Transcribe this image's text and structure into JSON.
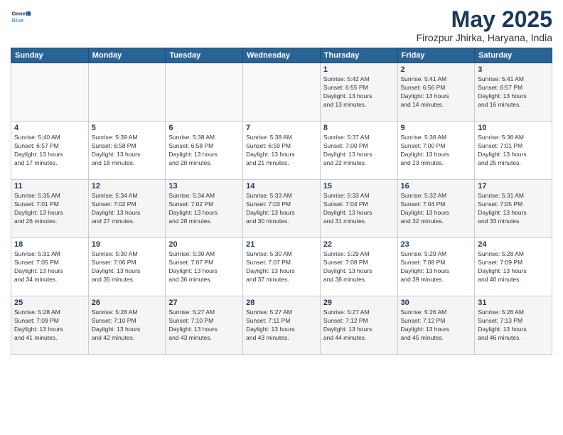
{
  "header": {
    "logo_line1": "General",
    "logo_line2": "Blue",
    "month_title": "May 2025",
    "location": "Firozpur Jhirka, Haryana, India"
  },
  "days_of_week": [
    "Sunday",
    "Monday",
    "Tuesday",
    "Wednesday",
    "Thursday",
    "Friday",
    "Saturday"
  ],
  "weeks": [
    [
      {
        "day": "",
        "content": ""
      },
      {
        "day": "",
        "content": ""
      },
      {
        "day": "",
        "content": ""
      },
      {
        "day": "",
        "content": ""
      },
      {
        "day": "1",
        "content": "Sunrise: 5:42 AM\nSunset: 6:55 PM\nDaylight: 13 hours\nand 13 minutes."
      },
      {
        "day": "2",
        "content": "Sunrise: 5:41 AM\nSunset: 6:56 PM\nDaylight: 13 hours\nand 14 minutes."
      },
      {
        "day": "3",
        "content": "Sunrise: 5:41 AM\nSunset: 6:57 PM\nDaylight: 13 hours\nand 16 minutes."
      }
    ],
    [
      {
        "day": "4",
        "content": "Sunrise: 5:40 AM\nSunset: 6:57 PM\nDaylight: 13 hours\nand 17 minutes."
      },
      {
        "day": "5",
        "content": "Sunrise: 5:39 AM\nSunset: 6:58 PM\nDaylight: 13 hours\nand 18 minutes."
      },
      {
        "day": "6",
        "content": "Sunrise: 5:38 AM\nSunset: 6:58 PM\nDaylight: 13 hours\nand 20 minutes."
      },
      {
        "day": "7",
        "content": "Sunrise: 5:38 AM\nSunset: 6:59 PM\nDaylight: 13 hours\nand 21 minutes."
      },
      {
        "day": "8",
        "content": "Sunrise: 5:37 AM\nSunset: 7:00 PM\nDaylight: 13 hours\nand 22 minutes."
      },
      {
        "day": "9",
        "content": "Sunrise: 5:36 AM\nSunset: 7:00 PM\nDaylight: 13 hours\nand 23 minutes."
      },
      {
        "day": "10",
        "content": "Sunrise: 5:36 AM\nSunset: 7:01 PM\nDaylight: 13 hours\nand 25 minutes."
      }
    ],
    [
      {
        "day": "11",
        "content": "Sunrise: 5:35 AM\nSunset: 7:01 PM\nDaylight: 13 hours\nand 26 minutes."
      },
      {
        "day": "12",
        "content": "Sunrise: 5:34 AM\nSunset: 7:02 PM\nDaylight: 13 hours\nand 27 minutes."
      },
      {
        "day": "13",
        "content": "Sunrise: 5:34 AM\nSunset: 7:02 PM\nDaylight: 13 hours\nand 28 minutes."
      },
      {
        "day": "14",
        "content": "Sunrise: 5:33 AM\nSunset: 7:03 PM\nDaylight: 13 hours\nand 30 minutes."
      },
      {
        "day": "15",
        "content": "Sunrise: 5:33 AM\nSunset: 7:04 PM\nDaylight: 13 hours\nand 31 minutes."
      },
      {
        "day": "16",
        "content": "Sunrise: 5:32 AM\nSunset: 7:04 PM\nDaylight: 13 hours\nand 32 minutes."
      },
      {
        "day": "17",
        "content": "Sunrise: 5:31 AM\nSunset: 7:05 PM\nDaylight: 13 hours\nand 33 minutes."
      }
    ],
    [
      {
        "day": "18",
        "content": "Sunrise: 5:31 AM\nSunset: 7:05 PM\nDaylight: 13 hours\nand 34 minutes."
      },
      {
        "day": "19",
        "content": "Sunrise: 5:30 AM\nSunset: 7:06 PM\nDaylight: 13 hours\nand 35 minutes."
      },
      {
        "day": "20",
        "content": "Sunrise: 5:30 AM\nSunset: 7:07 PM\nDaylight: 13 hours\nand 36 minutes."
      },
      {
        "day": "21",
        "content": "Sunrise: 5:30 AM\nSunset: 7:07 PM\nDaylight: 13 hours\nand 37 minutes."
      },
      {
        "day": "22",
        "content": "Sunrise: 5:29 AM\nSunset: 7:08 PM\nDaylight: 13 hours\nand 38 minutes."
      },
      {
        "day": "23",
        "content": "Sunrise: 5:29 AM\nSunset: 7:08 PM\nDaylight: 13 hours\nand 39 minutes."
      },
      {
        "day": "24",
        "content": "Sunrise: 5:28 AM\nSunset: 7:09 PM\nDaylight: 13 hours\nand 40 minutes."
      }
    ],
    [
      {
        "day": "25",
        "content": "Sunrise: 5:28 AM\nSunset: 7:09 PM\nDaylight: 13 hours\nand 41 minutes."
      },
      {
        "day": "26",
        "content": "Sunrise: 5:28 AM\nSunset: 7:10 PM\nDaylight: 13 hours\nand 42 minutes."
      },
      {
        "day": "27",
        "content": "Sunrise: 5:27 AM\nSunset: 7:10 PM\nDaylight: 13 hours\nand 43 minutes."
      },
      {
        "day": "28",
        "content": "Sunrise: 5:27 AM\nSunset: 7:11 PM\nDaylight: 13 hours\nand 43 minutes."
      },
      {
        "day": "29",
        "content": "Sunrise: 5:27 AM\nSunset: 7:12 PM\nDaylight: 13 hours\nand 44 minutes."
      },
      {
        "day": "30",
        "content": "Sunrise: 5:26 AM\nSunset: 7:12 PM\nDaylight: 13 hours\nand 45 minutes."
      },
      {
        "day": "31",
        "content": "Sunrise: 5:26 AM\nSunset: 7:13 PM\nDaylight: 13 hours\nand 46 minutes."
      }
    ]
  ]
}
